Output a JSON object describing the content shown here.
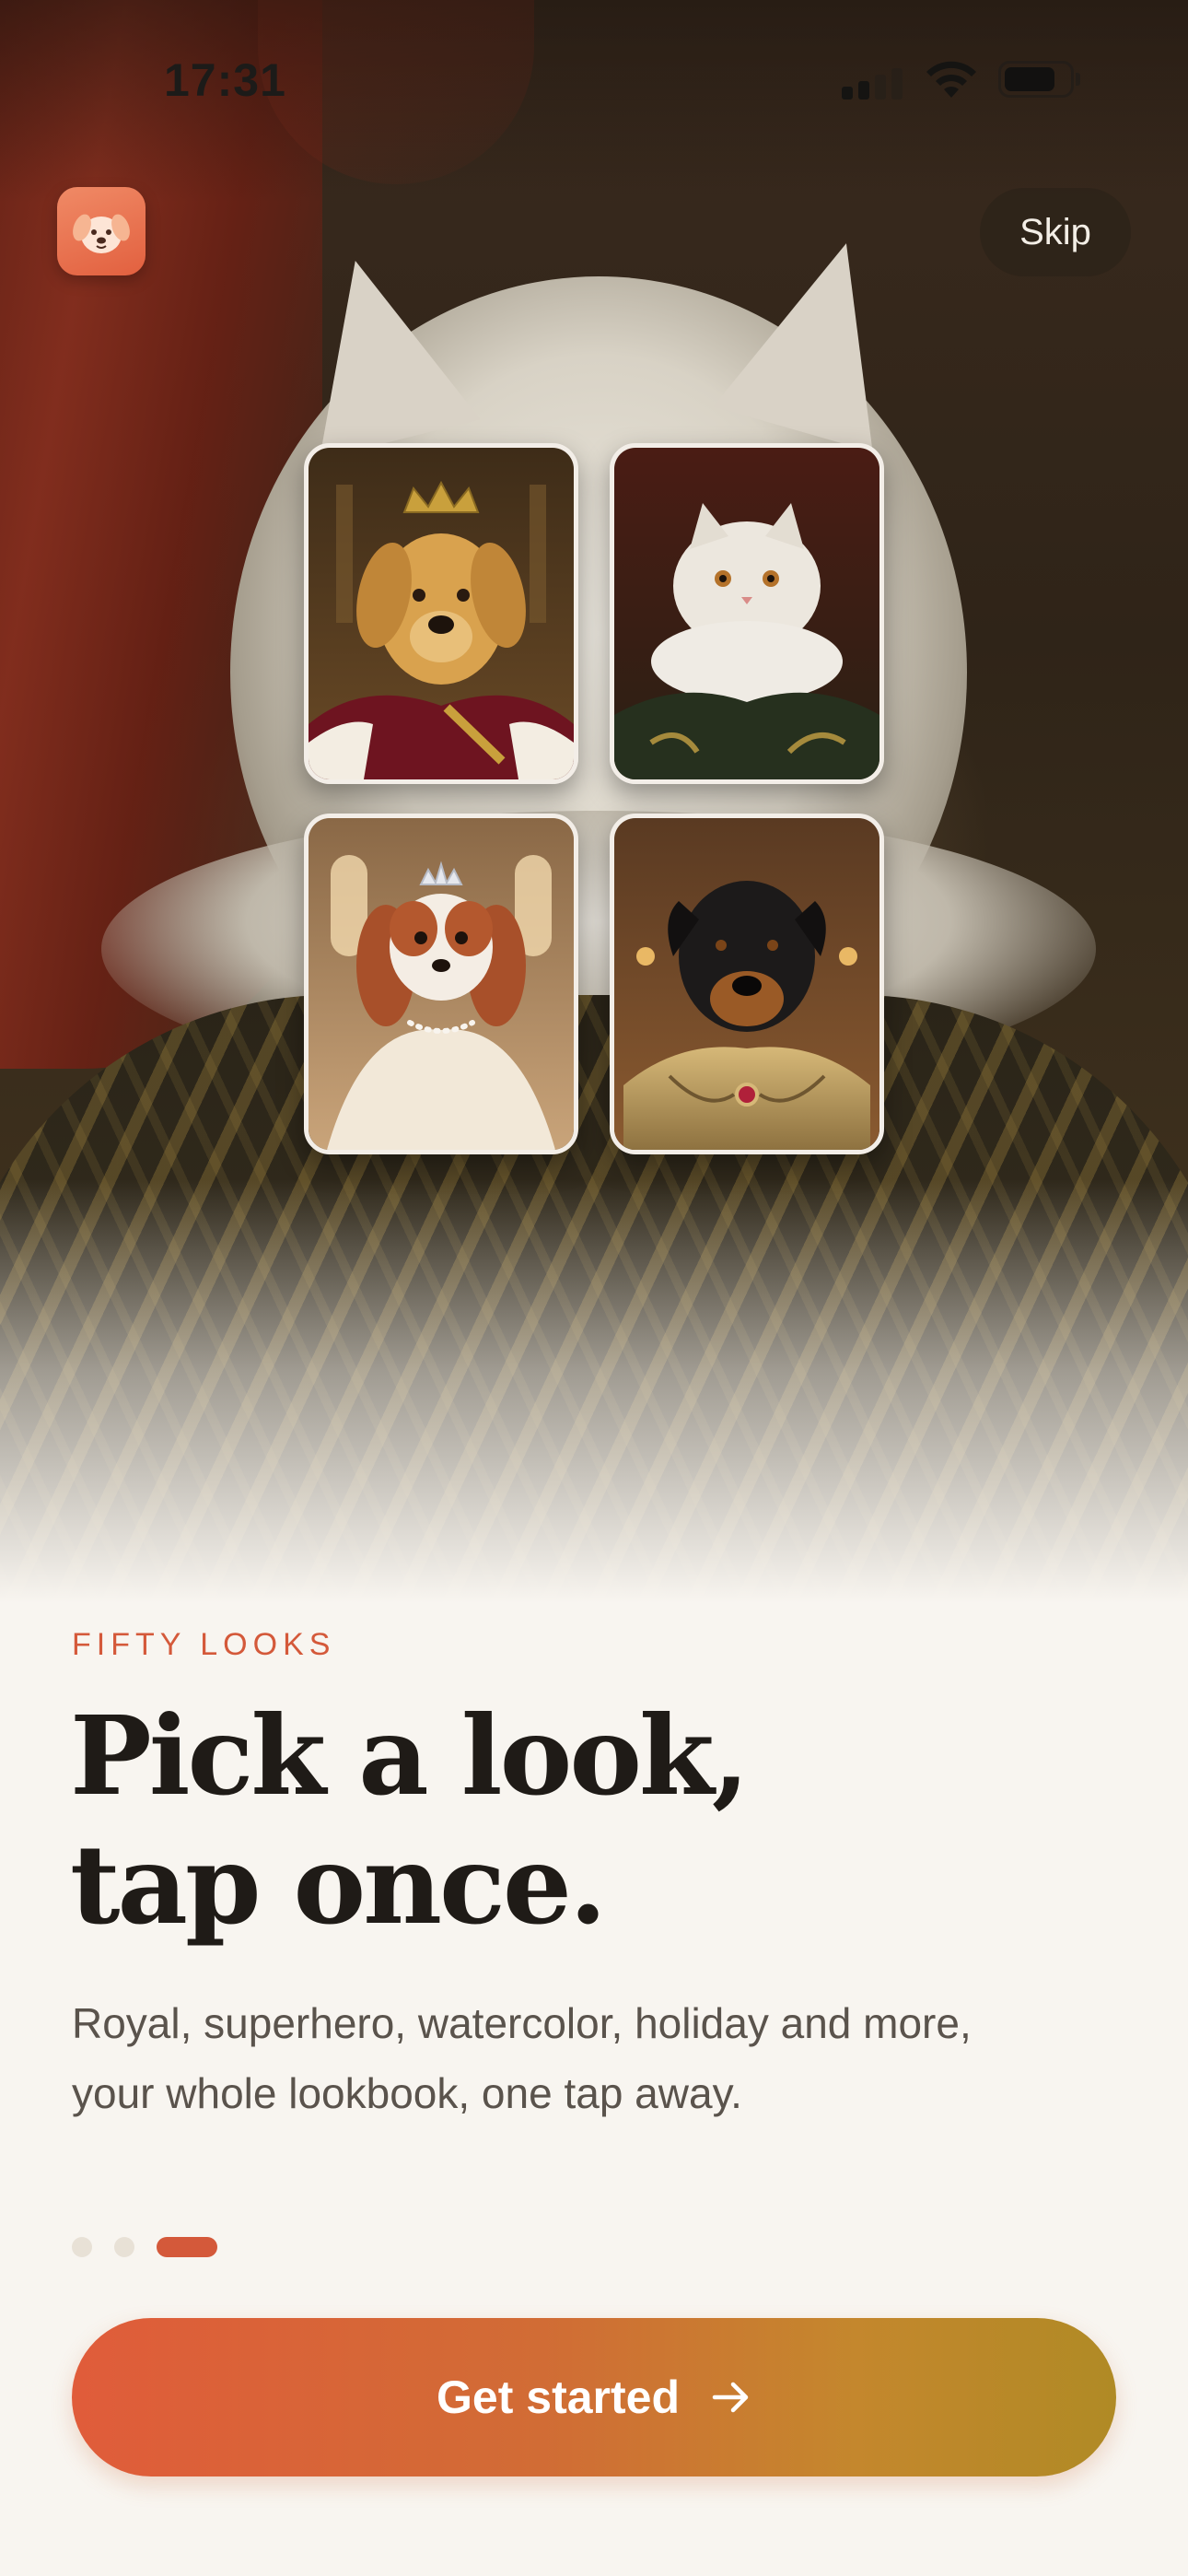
{
  "status_bar": {
    "time": "17:31",
    "battery_level": 0.8,
    "signal_bars": 2
  },
  "header": {
    "app_icon": "puppy-face-icon",
    "skip_label": "Skip"
  },
  "portraits": [
    {
      "subject": "golden retriever",
      "style": "royal king with crown"
    },
    {
      "subject": "white persian cat",
      "style": "renaissance ruff collar"
    },
    {
      "subject": "cavalier spaniel",
      "style": "princess with tiara"
    },
    {
      "subject": "rottweiler",
      "style": "knight in golden armor"
    }
  ],
  "content": {
    "eyebrow": "FIFTY LOOKS",
    "headline_line1": "Pick a look,",
    "headline_line2": "tap once.",
    "body_line1": "Royal, superhero, watercolor, holiday and more,",
    "body_line2": "your whole lookbook, one tap away."
  },
  "pagination": {
    "total": 3,
    "active_index": 2
  },
  "cta": {
    "label": "Get started",
    "icon": "arrow-right-icon"
  },
  "colors": {
    "accent": "#d4593a",
    "cta_start": "#e05c3a",
    "cta_end": "#b08a25",
    "background": "#f8f5f0",
    "headline": "#1f1b17",
    "dot_inactive": "#e8e1d6"
  }
}
